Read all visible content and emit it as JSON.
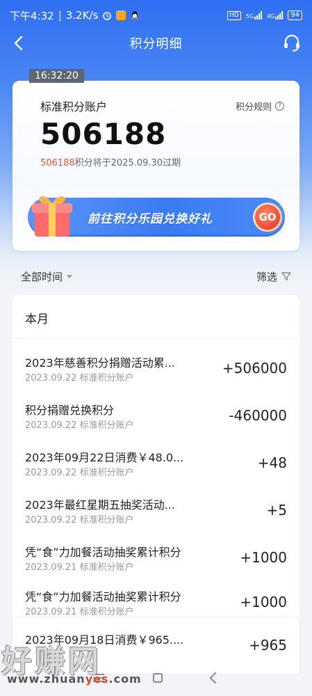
{
  "status_bar": {
    "time": "下午4:32",
    "speed": "3.2K/s",
    "network_left": "HD",
    "signal_1": "5G",
    "signal_2": "4G",
    "battery": "94"
  },
  "nav": {
    "title": "积分明细"
  },
  "overlay_time": "16:32:20",
  "account": {
    "title": "标准积分账户",
    "rules_label": "积分规则",
    "balance": "506188",
    "expire_amount": "506188",
    "expire_text": "积分将于2025.09.30过期",
    "banner_text": "前往积分乐园兑换好礼",
    "banner_button": "GO"
  },
  "filters": {
    "time_label": "全部时间",
    "filter_label": "筛选"
  },
  "list": {
    "section_title": "本月",
    "items": [
      {
        "title": "2023年慈善积分捐赠活动累...",
        "date": "2023.09.22",
        "account": "标准积分账户",
        "amount": "+506000"
      },
      {
        "title": "积分捐赠兑换积分",
        "date": "2023.09.22",
        "account": "标准积分账户",
        "amount": "-460000"
      },
      {
        "title": "2023年09月22日消费￥48.0...",
        "date": "2023.09.22",
        "account": "标准积分账户",
        "amount": "+48"
      },
      {
        "title": "2023年最红星期五抽奖活动...",
        "date": "2023.09.22",
        "account": "标准积分账户",
        "amount": "+5"
      },
      {
        "title": "凭“食”力加餐活动抽奖累计积分",
        "date": "2023.09.21",
        "account": "标准积分账户",
        "amount": "+1000"
      },
      {
        "title": "凭“食”力加餐活动抽奖累计积分",
        "date": "2023.09.21",
        "account": "标准积分账户",
        "amount": "+1000"
      },
      {
        "title": "2023年09月18日消费￥965....",
        "date": "",
        "account": "",
        "amount": "+965"
      }
    ]
  },
  "watermark": {
    "big": "好赚网",
    "small_prefix": "www.zhuan",
    "small_red": "yes",
    "small_suffix": ".com"
  },
  "colors": {
    "accent_blue": "#2f6ff2",
    "expire_red": "#e2563f"
  }
}
